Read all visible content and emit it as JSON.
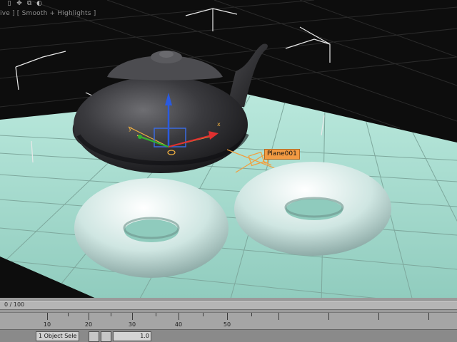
{
  "viewport": {
    "label": "ive ] [ Smooth + Highlights ]",
    "selected_object_tooltip": "Plane001",
    "gizmo_axis_x": "x",
    "gizmo_axis_y": "y",
    "colors": {
      "grid_plane": "#9fd8c8",
      "background": "#0d0d0d",
      "teapot": "#3a3a3e",
      "torus": "#cfe6e2",
      "gizmo_x": "#e03030",
      "gizmo_y": "#30b030",
      "gizmo_z": "#2a5ae0",
      "tooltip_bg": "#f29a42"
    }
  },
  "toolbar": {
    "icons": [
      "page-icon",
      "move-icon",
      "paste-icon",
      "shade-icon"
    ]
  },
  "time_slider": {
    "readout": "0 / 100"
  },
  "track_bar": {
    "ticks": [
      "10",
      "20",
      "30",
      "40",
      "50"
    ]
  },
  "status_bar": {
    "selection_text": "1 Object Sele",
    "coord_value": "1.0"
  }
}
